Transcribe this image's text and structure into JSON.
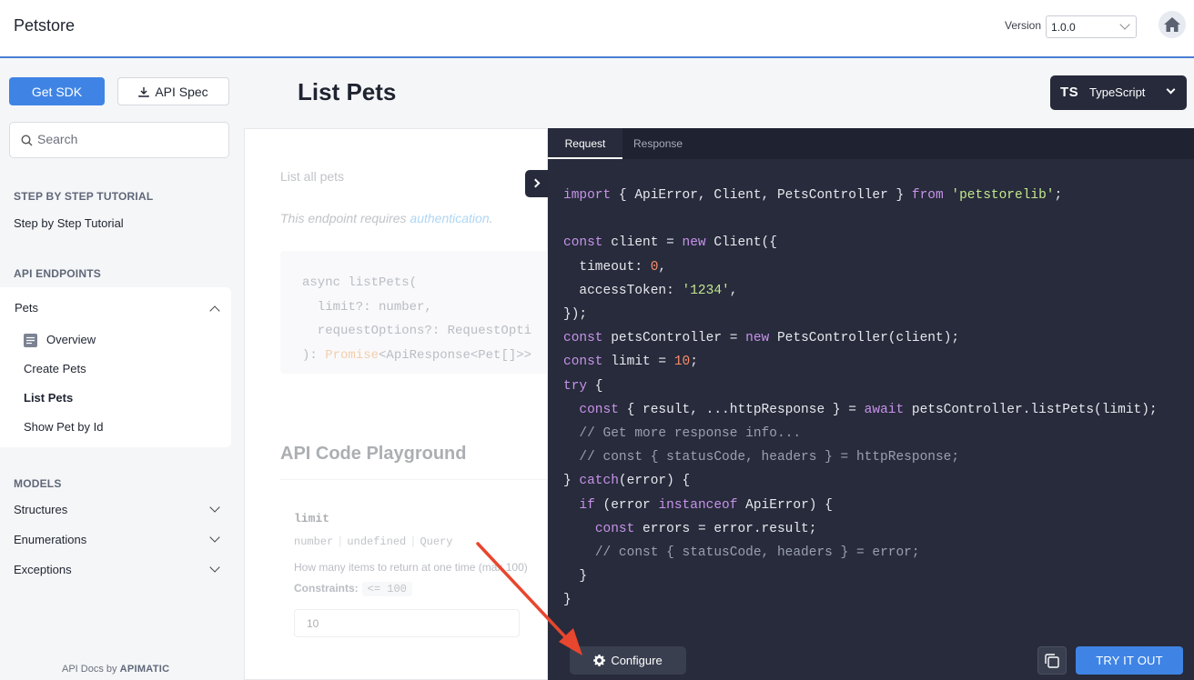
{
  "header": {
    "brand": "Petstore",
    "version_label": "Version",
    "version_value": "1.0.0",
    "home_icon": "home-icon"
  },
  "sidebar": {
    "get_sdk_label": "Get SDK",
    "api_spec_label": "API Spec",
    "search_placeholder": "Search",
    "sections": {
      "tutorial_title": "STEP BY STEP TUTORIAL",
      "tutorial_link": "Step by Step Tutorial",
      "endpoints_title": "API ENDPOINTS",
      "models_title": "MODELS"
    },
    "pets_group": {
      "label": "Pets",
      "items": [
        "Overview",
        "Create Pets",
        "List Pets",
        "Show Pet by Id"
      ],
      "active": "List Pets"
    },
    "models": [
      "Structures",
      "Enumerations",
      "Exceptions"
    ],
    "footer_prefix": "API Docs by",
    "footer_brand": "APIMATIC"
  },
  "main": {
    "title": "List Pets",
    "language": {
      "badge": "TS",
      "name": "TypeScript"
    },
    "description": "List all pets",
    "auth_prefix": "This endpoint requires ",
    "auth_link": "authentication",
    "auth_suffix": ".",
    "signature": {
      "line1": "async listPets(",
      "line2": "  limit?: number,",
      "line3": "  requestOptions?: RequestOpti",
      "line4_prefix": "): ",
      "line4_kw": "Promise",
      "line4_rest": "<ApiResponse<Pet[]>>"
    },
    "playground_title": "API Code Playground",
    "param": {
      "name": "limit",
      "type": "number",
      "default": "undefined",
      "location": "Query",
      "description": "How many items to return at one time (max 100)",
      "constraints_label": "Constraints:",
      "constraints_value": "<= 100",
      "input_value": "10"
    }
  },
  "code_panel": {
    "tabs": [
      "Request",
      "Response"
    ],
    "active_tab": "Request",
    "configure_label": "Configure",
    "try_label": "TRY IT OUT",
    "copy_icon": "copy-icon",
    "configure_icon": "gear-icon"
  },
  "colors": {
    "accent": "#3f84e5",
    "code_bg": "#272b3b",
    "annotation_arrow": "#e8462e"
  }
}
